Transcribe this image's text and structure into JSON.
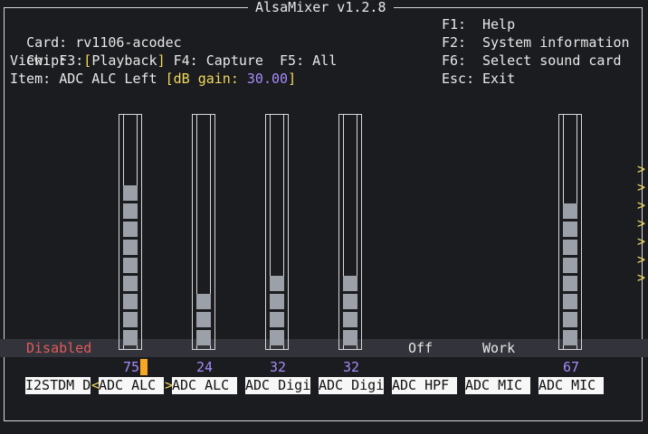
{
  "app_title": "AlsaMixer v1.2.8",
  "info": {
    "card_label": "Card:",
    "card_value": "rv1106-acodec",
    "chip_label": "Chip:",
    "view_label": "View:",
    "view_f3": "F3:",
    "view_bracket_open": "[",
    "view_playback": "Playback",
    "view_bracket_close": "]",
    "view_f4": "F4:",
    "view_capture": "Capture",
    "view_f5": "F5:",
    "view_all": "All",
    "item_label": "Item:",
    "item_value": "ADC ALC Left",
    "db_open": "[dB gain:",
    "db_value": "30.00",
    "db_close": "]"
  },
  "help": [
    {
      "key": "F1:",
      "text": "Help"
    },
    {
      "key": "F2:",
      "text": "System information"
    },
    {
      "key": "F6:",
      "text": "Select sound card"
    },
    {
      "key": "Esc:",
      "text": "Exit"
    }
  ],
  "controls": [
    {
      "label": "I2STDM D",
      "value": "",
      "level": null,
      "status": "Disabled"
    },
    {
      "label": "ADC ALC",
      "value": "75",
      "level": 0.75,
      "status": ""
    },
    {
      "label": "ADC ALC",
      "value": "24",
      "level": 0.24,
      "status": ""
    },
    {
      "label": "ADC Digi",
      "value": "32",
      "level": 0.32,
      "status": ""
    },
    {
      "label": "ADC Digi",
      "value": "32",
      "level": 0.32,
      "status": ""
    },
    {
      "label": "ADC HPF",
      "value": "",
      "level": null,
      "status": "Off"
    },
    {
      "label": "ADC MIC",
      "value": "",
      "level": null,
      "status": "Work"
    },
    {
      "label": "ADC MIC",
      "value": "67",
      "level": 0.67,
      "status": ""
    }
  ],
  "selection_marks": {
    "left": "<",
    "right": ">"
  },
  "right_arrows": [
    ">",
    ">",
    ">",
    ">",
    ">",
    ">",
    ">"
  ],
  "colors": {
    "accent": "#f0d95c",
    "value": "#a78bfa",
    "disabled": "#e05a5a",
    "cursor": "#f5a623"
  }
}
